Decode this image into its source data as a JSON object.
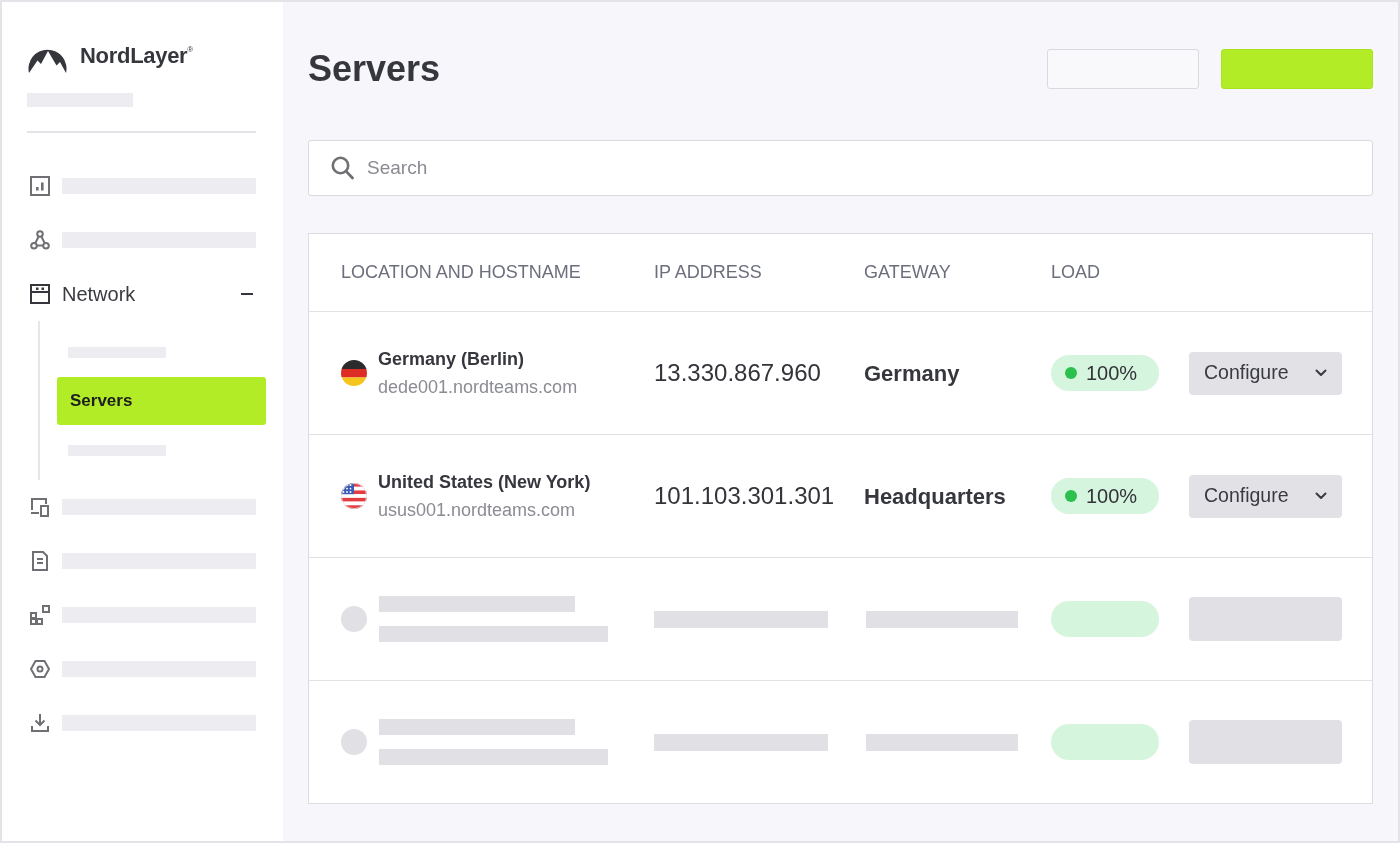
{
  "sidebar": {
    "logo": "NordLayer$^{®}$",
    "subtitle": {
      "kind": "placeholder"
    },
    "items": [
      {
        "kind": "placeholder",
        "selected": false
      },
      {
        "kind": "placeholder",
        "selected": false
      },
      {
        "kind": "group",
        "label": "Network",
        "selected": false,
        "expanded": true,
        "children": [
          {
            "kind": "placeholder",
            "selected": false
          },
          {
            "kind": "link",
            "label": "Servers",
            "selected": true
          },
          {
            "kind": "placeholder",
            "selected": false
          }
        ]
      },
      {
        "kind": "placeholder",
        "selected": false
      },
      {
        "kind": "placeholder",
        "selected": false
      },
      {
        "kind": "placeholder",
        "selected": false
      },
      {
        "kind": "placeholder",
        "selected": false
      },
      {
        "kind": "placeholder",
        "selected": false
      }
    ]
  },
  "page": {
    "title": "Servers",
    "actions": [
      {
        "kind": "outline"
      },
      {
        "kind": "primary"
      }
    ]
  },
  "search": {
    "placeholder": "Search"
  },
  "table": {
    "columns": [
      "LOCATION AND HOSTNAME",
      "IP ADDRESS",
      "GATEWAY",
      "LOAD"
    ],
    "rows": [
      {
        "kind": "server",
        "location": "Germany (Berlin)",
        "hostname": "dede001.nordteams.com",
        "ip": "13.330.867.960",
        "gateway": "Germany",
        "load": "100%",
        "action": "Configure"
      },
      {
        "kind": "server",
        "location": "United States (New York)",
        "hostname": "usus001.nordteams.com",
        "ip": "101.103.301.301",
        "gateway": "Headquarters",
        "load": "100%",
        "action": "Configure"
      },
      {
        "kind": "placeholder"
      },
      {
        "kind": "placeholder"
      }
    ]
  }
}
